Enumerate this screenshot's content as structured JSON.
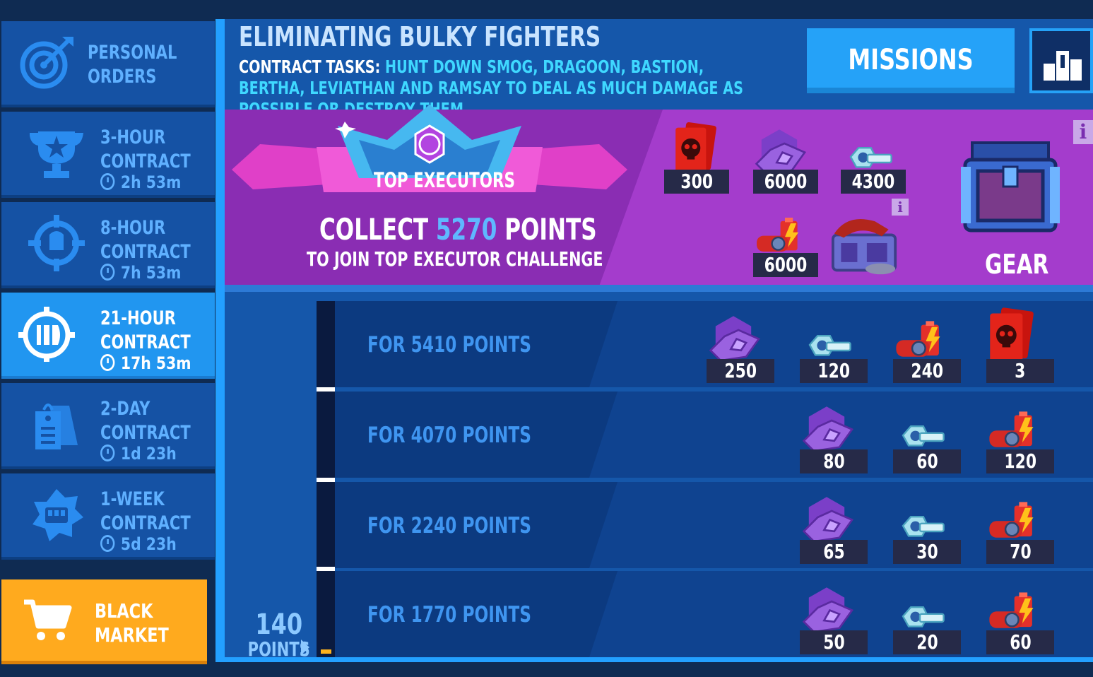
{
  "sidebar": {
    "items": [
      {
        "line1": "PERSONAL",
        "line2": "ORDERS",
        "timer": "",
        "icon": "target-icon",
        "active": false
      },
      {
        "line1": "3-HOUR",
        "line2": "CONTRACT",
        "timer": "2h 53m",
        "icon": "trophy-icon",
        "active": false
      },
      {
        "line1": "8-HOUR",
        "line2": "CONTRACT",
        "timer": "7h 53m",
        "icon": "crosshair-icon",
        "active": false
      },
      {
        "line1": "21-HOUR",
        "line2": "CONTRACT",
        "timer": "17h 53m",
        "icon": "contract-emblem-icon",
        "active": true
      },
      {
        "line1": "2-DAY",
        "line2": "CONTRACT",
        "timer": "1d 23h",
        "icon": "tags-icon",
        "active": false
      },
      {
        "line1": "1-WEEK",
        "line2": "CONTRACT",
        "timer": "5d 23h",
        "icon": "fist-badge-icon",
        "active": false
      }
    ],
    "black_market": {
      "line1": "BLACK",
      "line2": "MARKET",
      "icon": "cart-icon"
    }
  },
  "header": {
    "title": "ELIMINATING BULKY FIGHTERS",
    "tasks_label": "CONTRACT TASKS:",
    "tasks_text": "HUNT DOWN SMOG, DRAGOON, BASTION, BERTHA, LEVIATHAN AND RAMSAY TO DEAL AS MUCH DAMAGE AS POSSIBLE OR DESTROY THEM",
    "missions_label": "MISSIONS",
    "leaderboard_icon": "leaderboard-icon"
  },
  "top_executors": {
    "badge_label": "TOP EXECUTORS",
    "collect_prefix": "COLLECT",
    "collect_points": "5270",
    "collect_suffix": "POINTS",
    "join_text": "TO JOIN TOP EXECUTOR CHALLENGE",
    "rewards": [
      {
        "icon": "skull-cards-icon",
        "qty": "300"
      },
      {
        "icon": "hex-chip-icon",
        "qty": "6000"
      },
      {
        "icon": "nut-bolt-icon",
        "qty": "4300"
      },
      {
        "icon": "battery-icon",
        "qty": "6000"
      },
      {
        "icon": "crate-icon",
        "qty": ""
      }
    ],
    "gear_label": "GEAR",
    "info_label": "i"
  },
  "tiers": [
    {
      "label": "FOR 5410 POINTS",
      "rewards": [
        {
          "icon": "hex-chip-icon",
          "qty": "250"
        },
        {
          "icon": "nut-bolt-icon",
          "qty": "120"
        },
        {
          "icon": "battery-icon",
          "qty": "240"
        },
        {
          "icon": "skull-cards-icon",
          "qty": "3"
        }
      ]
    },
    {
      "label": "FOR 4070 POINTS",
      "rewards": [
        {
          "icon": "hex-chip-icon",
          "qty": "80"
        },
        {
          "icon": "nut-bolt-icon",
          "qty": "60"
        },
        {
          "icon": "battery-icon",
          "qty": "120"
        }
      ]
    },
    {
      "label": "FOR 2240 POINTS",
      "rewards": [
        {
          "icon": "hex-chip-icon",
          "qty": "65"
        },
        {
          "icon": "nut-bolt-icon",
          "qty": "30"
        },
        {
          "icon": "battery-icon",
          "qty": "70"
        }
      ]
    },
    {
      "label": "FOR 1770 POINTS",
      "rewards": [
        {
          "icon": "hex-chip-icon",
          "qty": "50"
        },
        {
          "icon": "nut-bolt-icon",
          "qty": "20"
        },
        {
          "icon": "battery-icon",
          "qty": "60"
        }
      ]
    }
  ],
  "progress": {
    "points": "140",
    "unit": "POINTS",
    "current": 140,
    "max": 5410
  },
  "colors": {
    "accent": "#23a0ff",
    "banner": "#a43ccc",
    "black_market": "#ffaa1e",
    "highlight": "#3fd8ff"
  }
}
